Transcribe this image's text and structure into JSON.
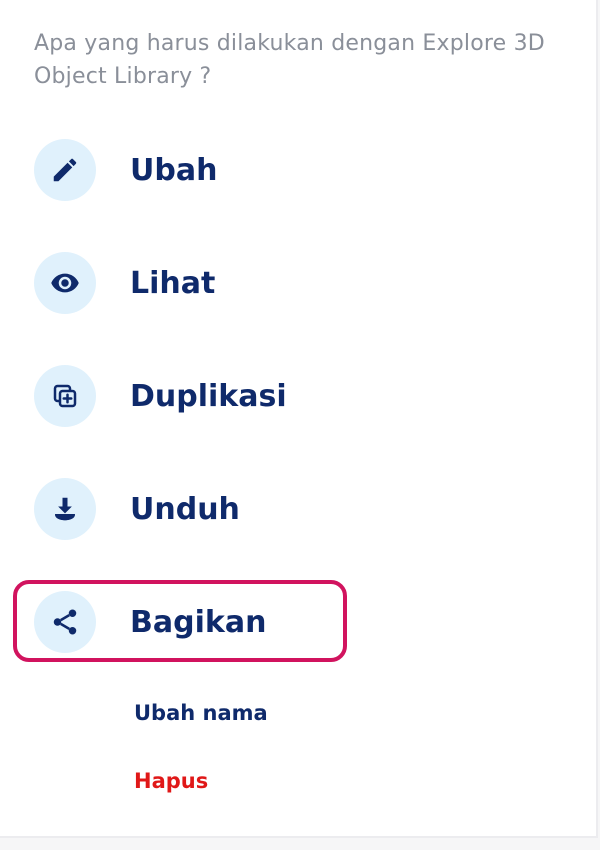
{
  "prompt": "Apa yang harus dilakukan dengan Explore 3D Object Library ?",
  "actions": [
    {
      "label": "Ubah",
      "icon": "pencil-icon"
    },
    {
      "label": "Lihat",
      "icon": "eye-icon"
    },
    {
      "label": "Duplikasi",
      "icon": "duplicate-icon"
    },
    {
      "label": "Unduh",
      "icon": "download-icon"
    },
    {
      "label": "Bagikan",
      "icon": "share-icon"
    }
  ],
  "secondary": {
    "rename": "Ubah nama",
    "delete": "Hapus"
  },
  "colors": {
    "label": "#0f2a6b",
    "icon_bg": "#e0f1fc",
    "highlight": "#d1135e",
    "danger": "#e01818",
    "prompt": "#8a8f99"
  }
}
